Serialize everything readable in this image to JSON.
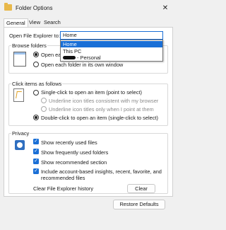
{
  "window": {
    "title": "Folder Options",
    "close_symbol": "✕"
  },
  "tabs": [
    {
      "label": "General",
      "active": true
    },
    {
      "label": "View",
      "active": false
    },
    {
      "label": "Search",
      "active": false
    }
  ],
  "open_explorer": {
    "label": "Open File Explorer to:",
    "value": "Home",
    "options": [
      "Home",
      "This PC",
      "- Personal"
    ]
  },
  "browse_folders": {
    "title": "Browse folders",
    "opt1_prefix": "Open ea",
    "opt2": "Open each folder in its own window"
  },
  "click_items": {
    "title": "Click items as follows",
    "single": "Single-click to open an item (point to select)",
    "underline_consistent": "Underline icon titles consistent with my browser",
    "underline_point": "Underline icon titles only when I point at them",
    "double": "Double-click to open an item (single-click to select)"
  },
  "privacy": {
    "title": "Privacy",
    "recent": "Show recently used files",
    "frequent": "Show frequently used folders",
    "recommended": "Show recommended section",
    "insights_line1": "Include account-based insights, recent, favorite, and",
    "insights_line2": "recommended files",
    "clear_label": "Clear File Explorer history",
    "clear_button": "Clear"
  },
  "restore_button": "Restore Defaults",
  "accent": "#1a6fd6"
}
